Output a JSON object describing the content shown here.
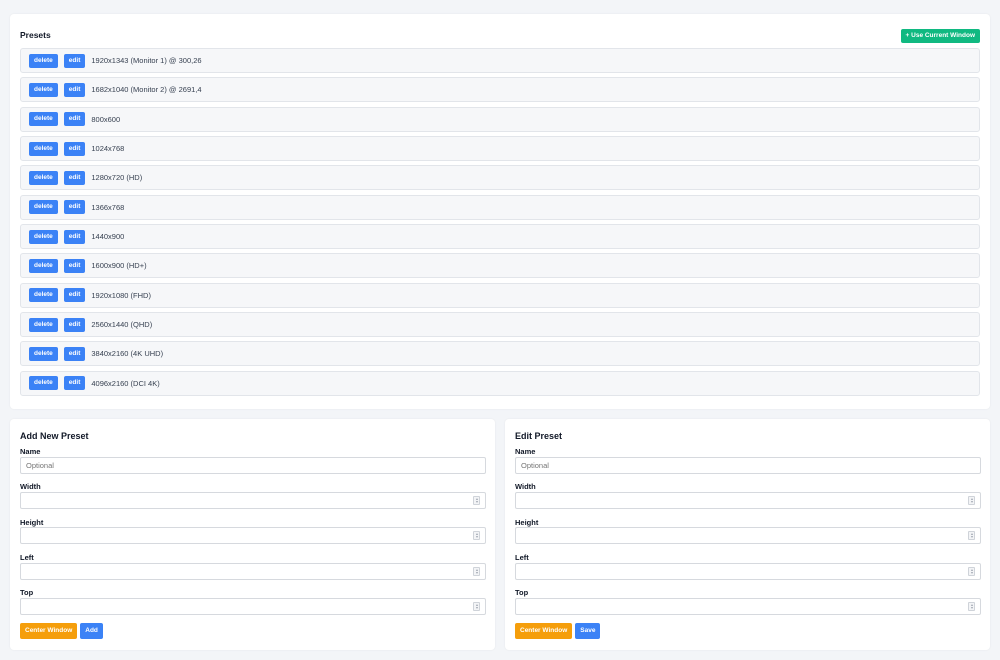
{
  "presets": {
    "title": "Presets",
    "use_current_label": "+ Use Current Window",
    "delete_label": "delete",
    "edit_label": "edit",
    "items": [
      "1920x1343 (Monitor 1) @ 300,26",
      "1682x1040 (Monitor 2) @ 2691,4",
      "800x600",
      "1024x768",
      "1280x720 (HD)",
      "1366x768",
      "1440x900",
      "1600x900 (HD+)",
      "1920x1080 (FHD)",
      "2560x1440 (QHD)",
      "3840x2160 (4K UHD)",
      "4096x2160 (DCI 4K)"
    ]
  },
  "add_form": {
    "title": "Add New Preset",
    "name_label": "Name",
    "name_placeholder": "Optional",
    "width_label": "Width",
    "height_label": "Height",
    "left_label": "Left",
    "top_label": "Top",
    "center_label": "Center Window",
    "submit_label": "Add"
  },
  "edit_form": {
    "title": "Edit Preset",
    "name_label": "Name",
    "name_placeholder": "Optional",
    "width_label": "Width",
    "height_label": "Height",
    "left_label": "Left",
    "top_label": "Top",
    "center_label": "Center Window",
    "submit_label": "Save"
  },
  "colors": {
    "primary": "#3b82f6",
    "success": "#10b981",
    "warning": "#f59e0b"
  }
}
